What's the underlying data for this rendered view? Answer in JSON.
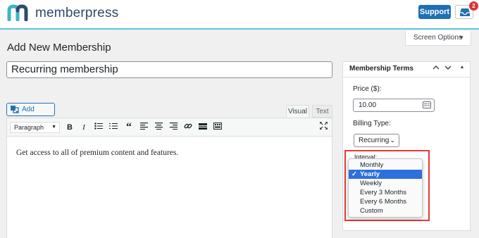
{
  "brand": {
    "name": "memberpress",
    "accent": "#1e6fb5"
  },
  "topbar": {
    "support_label": "Support",
    "notification_count": "2"
  },
  "screen_options": {
    "label": "Screen Options"
  },
  "page": {
    "title": "Add New Membership"
  },
  "editor": {
    "title_value": "Recurring membership",
    "add_media_label": "Add Media",
    "tab_visual": "Visual",
    "tab_text": "Text",
    "format_select": "Paragraph",
    "content": "Get access to all of premium content and features."
  },
  "terms": {
    "title": "Membership Terms",
    "price_label": "Price ($):",
    "price_value": "10.00",
    "billing_label": "Billing Type:",
    "billing_value": "Recurring",
    "interval_label": "Interval:",
    "interval_options": [
      "Monthly",
      "Yearly",
      "Weekly",
      "Every 3 Months",
      "Every 6 Months",
      "Custom"
    ],
    "interval_selected": "Yearly",
    "obscured_text": "s"
  }
}
